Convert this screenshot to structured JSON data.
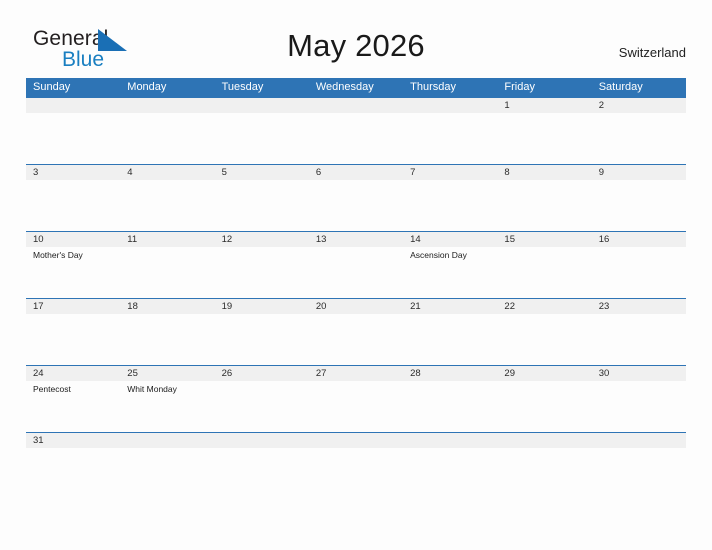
{
  "brand": {
    "word_one": "General",
    "word_two": "Blue",
    "flag_icon": "blue-flag-triangle-icon",
    "accent_blue": "#1a7fc1"
  },
  "header": {
    "title": "May 2026",
    "region": "Switzerland"
  },
  "colors": {
    "header_blue": "#2e74b5",
    "date_band_gray": "#f0f0f0",
    "page_background": "#fdfdfd",
    "text_dark": "#231f20"
  },
  "calendar": {
    "weekdays": [
      "Sunday",
      "Monday",
      "Tuesday",
      "Wednesday",
      "Thursday",
      "Friday",
      "Saturday"
    ],
    "weeks": [
      {
        "height": "tall",
        "days": [
          {
            "num": "",
            "event": ""
          },
          {
            "num": "",
            "event": ""
          },
          {
            "num": "",
            "event": ""
          },
          {
            "num": "",
            "event": ""
          },
          {
            "num": "",
            "event": ""
          },
          {
            "num": "1",
            "event": ""
          },
          {
            "num": "2",
            "event": ""
          }
        ]
      },
      {
        "height": "tall",
        "days": [
          {
            "num": "3",
            "event": ""
          },
          {
            "num": "4",
            "event": ""
          },
          {
            "num": "5",
            "event": ""
          },
          {
            "num": "6",
            "event": ""
          },
          {
            "num": "7",
            "event": ""
          },
          {
            "num": "8",
            "event": ""
          },
          {
            "num": "9",
            "event": ""
          }
        ]
      },
      {
        "height": "tall",
        "days": [
          {
            "num": "10",
            "event": "Mother's Day"
          },
          {
            "num": "11",
            "event": ""
          },
          {
            "num": "12",
            "event": ""
          },
          {
            "num": "13",
            "event": ""
          },
          {
            "num": "14",
            "event": "Ascension Day"
          },
          {
            "num": "15",
            "event": ""
          },
          {
            "num": "16",
            "event": ""
          }
        ]
      },
      {
        "height": "tall",
        "days": [
          {
            "num": "17",
            "event": ""
          },
          {
            "num": "18",
            "event": ""
          },
          {
            "num": "19",
            "event": ""
          },
          {
            "num": "20",
            "event": ""
          },
          {
            "num": "21",
            "event": ""
          },
          {
            "num": "22",
            "event": ""
          },
          {
            "num": "23",
            "event": ""
          }
        ]
      },
      {
        "height": "tall",
        "days": [
          {
            "num": "24",
            "event": "Pentecost"
          },
          {
            "num": "25",
            "event": "Whit Monday"
          },
          {
            "num": "26",
            "event": ""
          },
          {
            "num": "27",
            "event": ""
          },
          {
            "num": "28",
            "event": ""
          },
          {
            "num": "29",
            "event": ""
          },
          {
            "num": "30",
            "event": ""
          }
        ]
      },
      {
        "height": "short",
        "days": [
          {
            "num": "31",
            "event": ""
          },
          {
            "num": "",
            "event": ""
          },
          {
            "num": "",
            "event": ""
          },
          {
            "num": "",
            "event": ""
          },
          {
            "num": "",
            "event": ""
          },
          {
            "num": "",
            "event": ""
          },
          {
            "num": "",
            "event": ""
          }
        ]
      }
    ]
  }
}
